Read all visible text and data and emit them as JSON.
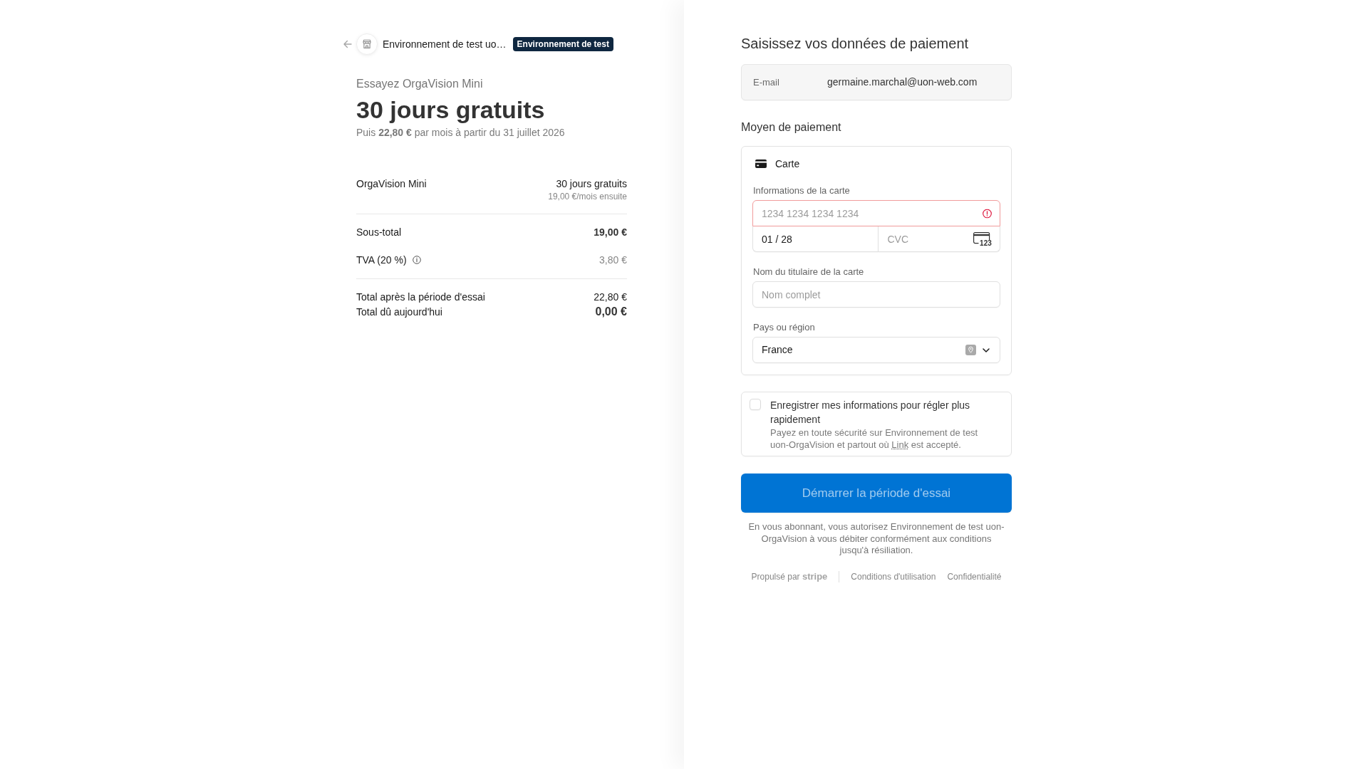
{
  "header": {
    "merchant": "Environnement de test uo…",
    "badge": "Environnement de test"
  },
  "summary": {
    "eyebrow": "Essayez OrgaVision Mini",
    "headline": "30 jours gratuits",
    "subline": "Puis **22,80 €** par mois à partir du 31 juillet 2026",
    "line_items": [
      {
        "name": "OrgaVision Mini",
        "price": "30 jours gratuits",
        "note": "19,00 €/mois ensuite"
      }
    ],
    "sections": [
      {
        "rows": [
          {
            "kind": "subtotal",
            "label": "Sous-total",
            "value": "19,00 €"
          },
          {
            "kind": "tax",
            "label": "TVA (20 %)",
            "value": "3,80 €"
          }
        ]
      },
      {
        "rows": [
          {
            "kind": "after_trial",
            "label": "Total après la période d'essai",
            "value": "22,80 €"
          },
          {
            "kind": "due_today",
            "label": "Total dû aujourd'hui",
            "value": "0,00 €"
          }
        ]
      }
    ]
  },
  "payment": {
    "title": "Saisissez vos données de paiement",
    "email": {
      "label": "E-mail",
      "value": "germaine.marchal@uon-web.com"
    },
    "method_heading": "Moyen de paiement",
    "method": {
      "label": "Carte",
      "card_info_label": "Informations de la carte",
      "card_number": {
        "placeholder": "1234 1234 1234 1234",
        "invalid": true
      },
      "expiry": {
        "value": "01 / 28"
      },
      "cvc": {
        "placeholder": "CVC",
        "icon_text": "123"
      },
      "holder": {
        "label": "Nom du titulaire de la carte",
        "placeholder": "Nom complet"
      },
      "country": {
        "label": "Pays ou région",
        "value": "France"
      }
    },
    "save_info": {
      "checked": false,
      "title": "Enregistrer mes informations pour régler plus rapidement",
      "description": {
        "before": "Payez en toute sécurité sur Environnement de test uon-OrgaVision et partout où",
        "link": "Link",
        "after": "est accepté."
      }
    },
    "submit": {
      "label": "Démarrer la période d'essai",
      "disabled": true
    },
    "legal": "En vous abonnant, vous autorisez Environnement de test uon-OrgaVision à vous débiter conformément aux conditions jusqu'à résiliation.",
    "footer": {
      "powered_by": "Propulsé par **stripe**",
      "links": [
        "Conditions d'utilisation",
        "Confidentialité"
      ]
    }
  }
}
